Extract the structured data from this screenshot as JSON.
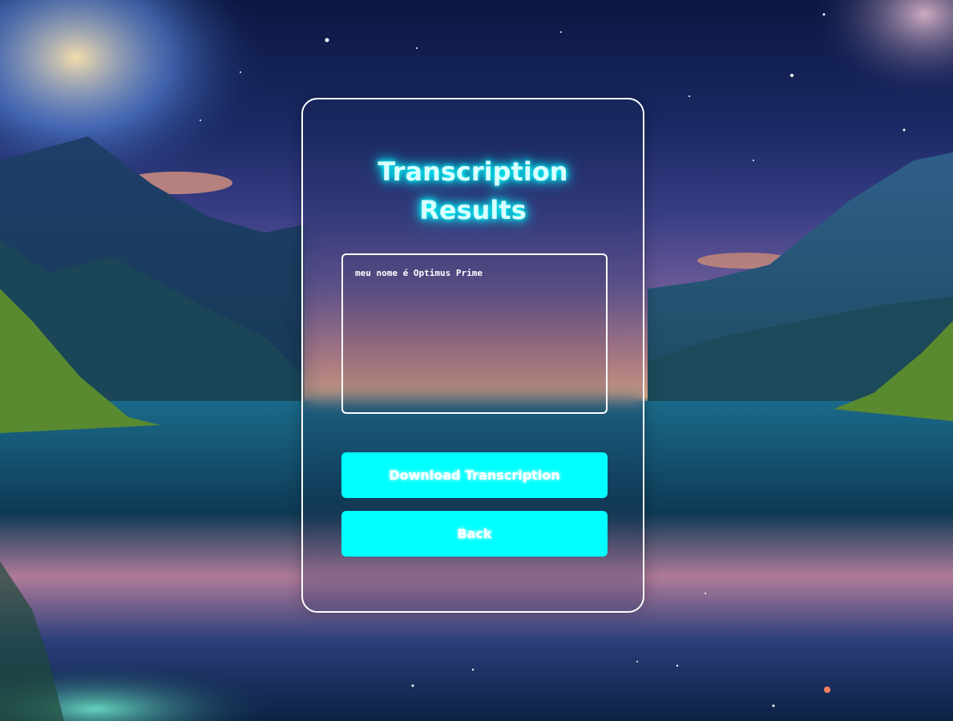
{
  "card": {
    "title_line1": "Transcription",
    "title_line2": "Results",
    "transcript_text": "meu nome é Optimus Prime"
  },
  "actions": {
    "download_label": "Download Transcription",
    "back_label": "Back"
  },
  "colors": {
    "accent": "#00ffff",
    "border": "#ffffff",
    "title_glow": "#00ffff"
  }
}
